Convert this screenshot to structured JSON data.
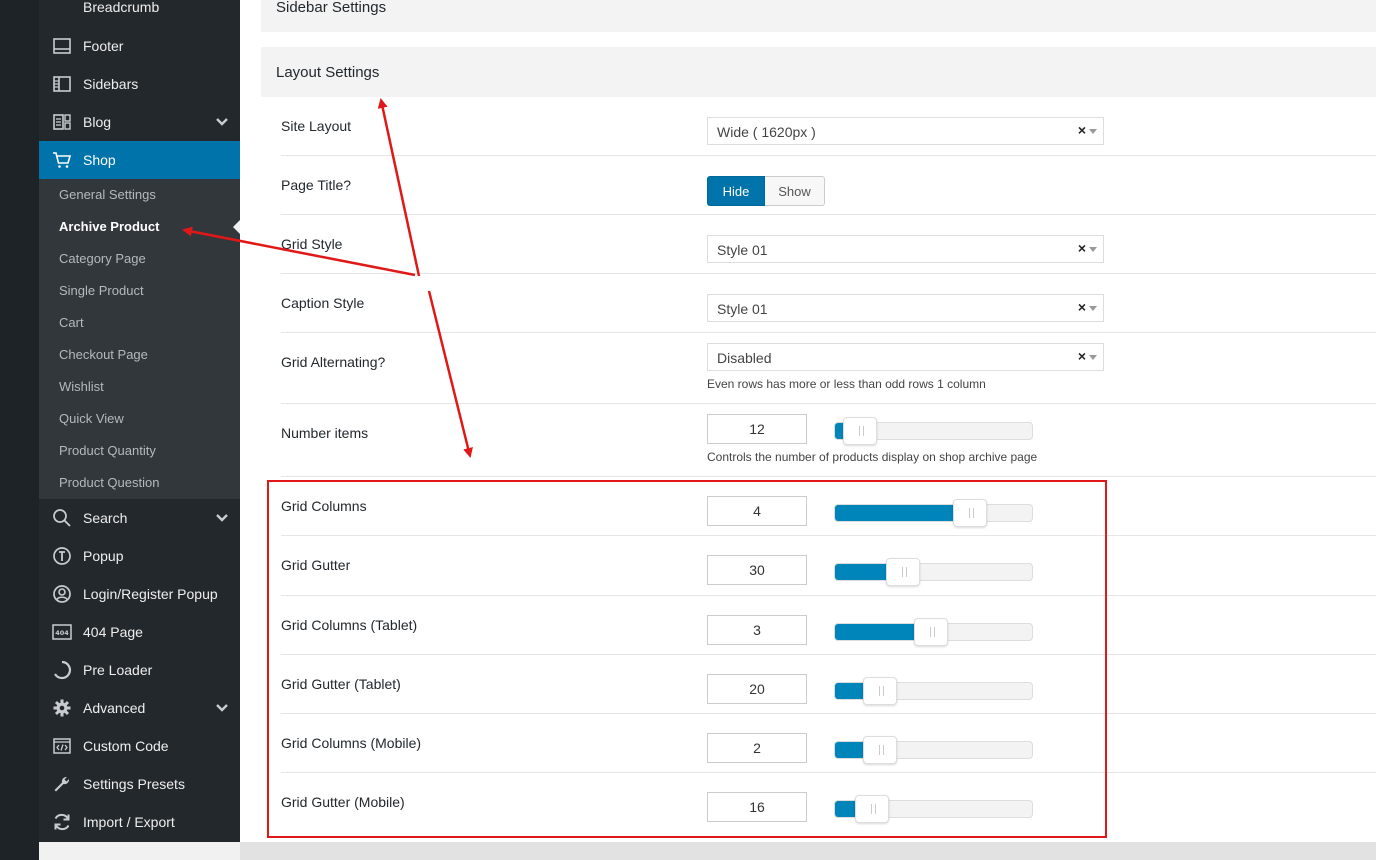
{
  "sidebar": {
    "top_item": "Breadcrumb",
    "items": [
      {
        "label": "Footer",
        "icon": "footer-icon"
      },
      {
        "label": "Sidebars",
        "icon": "sidebars-icon"
      },
      {
        "label": "Blog",
        "icon": "blog-icon",
        "expandable": true
      },
      {
        "label": "Shop",
        "icon": "cart-icon",
        "active": true
      }
    ],
    "submenu": [
      "General Settings",
      "Archive Product",
      "Category Page",
      "Single Product",
      "Cart",
      "Checkout Page",
      "Wishlist",
      "Quick View",
      "Product Quantity",
      "Product Question"
    ],
    "submenu_current": "Archive Product",
    "items_bottom": [
      {
        "label": "Search",
        "icon": "search-icon",
        "expandable": true
      },
      {
        "label": "Popup",
        "icon": "popup-icon"
      },
      {
        "label": "Login/Register Popup",
        "icon": "user-circle-icon"
      },
      {
        "label": "404 Page",
        "icon": "404-icon",
        "icon_text": "404"
      },
      {
        "label": "Pre Loader",
        "icon": "loader-icon"
      },
      {
        "label": "Advanced",
        "icon": "gear-icon",
        "expandable": true
      },
      {
        "label": "Custom Code",
        "icon": "code-icon"
      },
      {
        "label": "Settings Presets",
        "icon": "wrench-icon"
      },
      {
        "label": "Import / Export",
        "icon": "sync-icon"
      }
    ]
  },
  "panels": {
    "sidebar_settings": "Sidebar Settings",
    "layout_settings": "Layout Settings"
  },
  "fields": {
    "site_layout": {
      "label": "Site Layout",
      "value": "Wide ( 1620px )",
      "clear": "×"
    },
    "page_title": {
      "label": "Page Title?",
      "options": [
        "Hide",
        "Show"
      ],
      "selected": "Hide"
    },
    "grid_style": {
      "label": "Grid Style",
      "value": "Style 01",
      "clear": "×"
    },
    "caption_style": {
      "label": "Caption Style",
      "value": "Style 01",
      "clear": "×"
    },
    "grid_alternating": {
      "label": "Grid Alternating?",
      "value": "Disabled",
      "clear": "×",
      "desc": "Even rows has more or less than odd rows 1 column"
    },
    "number_items": {
      "label": "Number items",
      "value": "12",
      "fill": 0.04,
      "desc": "Controls the number of products display on shop archive page"
    },
    "grid_columns": {
      "label": "Grid Columns",
      "value": "4",
      "fill": 0.6
    },
    "grid_gutter": {
      "label": "Grid Gutter",
      "value": "30",
      "fill": 0.26
    },
    "grid_columns_tablet": {
      "label": "Grid Columns (Tablet)",
      "value": "3",
      "fill": 0.4
    },
    "grid_gutter_tablet": {
      "label": "Grid Gutter (Tablet)",
      "value": "20",
      "fill": 0.14
    },
    "grid_columns_mobile": {
      "label": "Grid Columns (Mobile)",
      "value": "2",
      "fill": 0.14
    },
    "grid_gutter_mobile": {
      "label": "Grid Gutter (Mobile)",
      "value": "16",
      "fill": 0.1
    }
  },
  "colors": {
    "accent": "#0073aa",
    "annotation": "#e01818"
  }
}
